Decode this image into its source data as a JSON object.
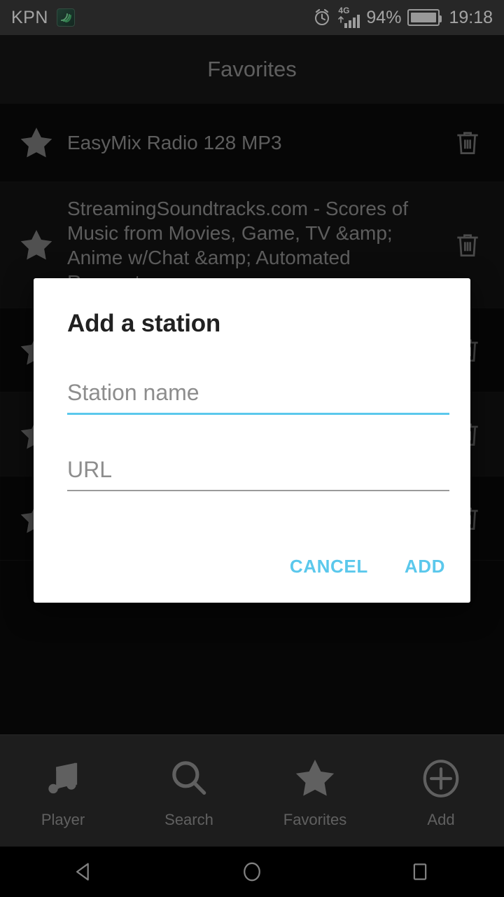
{
  "status_bar": {
    "carrier": "KPN",
    "carrier_icon": "wifi-calling-icon",
    "alarm_icon": "alarm-clock-icon",
    "network_type": "4G",
    "signal_icon": "signal-bars-icon",
    "battery_percent": "94%",
    "battery_icon": "battery-full-icon",
    "clock": "19:18"
  },
  "app_bar": {
    "title": "Favorites"
  },
  "favorites": {
    "star_icon": "star-icon",
    "delete_icon": "trash-icon",
    "items": [
      {
        "name": "EasyMix Radio 128 MP3"
      },
      {
        "name": "StreamingSoundtracks.com - Scores of Music from Movies, Game, TV &amp; Anime w/Chat &amp; Automated Requests"
      },
      {
        "name": ""
      },
      {
        "name": ""
      },
      {
        "name": ""
      }
    ]
  },
  "dialog": {
    "title": "Add a station",
    "station_name": {
      "value": "",
      "placeholder": "Station name",
      "focused": true,
      "underline_color": "#5bc8ec"
    },
    "url": {
      "value": "",
      "placeholder": "URL",
      "focused": false,
      "underline_color": "#9a9a9a"
    },
    "cancel_label": "CANCEL",
    "add_label": "ADD",
    "accent_color": "#5bc8ec"
  },
  "tab_bar": {
    "tabs": [
      {
        "label": "Player",
        "icon": "music-note-icon"
      },
      {
        "label": "Search",
        "icon": "magnifier-icon"
      },
      {
        "label": "Favorites",
        "icon": "star-icon"
      },
      {
        "label": "Add",
        "icon": "plus-circle-icon"
      }
    ]
  },
  "system_nav": {
    "back": "back-triangle-icon",
    "home": "home-circle-icon",
    "recents": "recents-square-icon"
  }
}
